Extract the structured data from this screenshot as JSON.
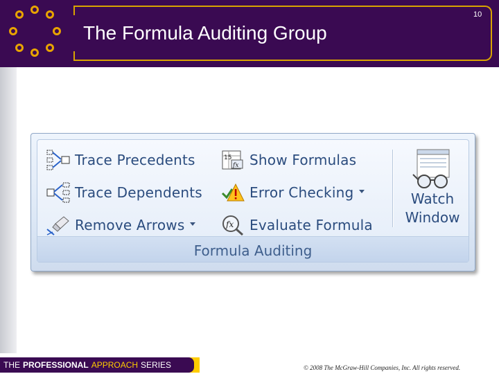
{
  "slide": {
    "title": "The Formula Auditing Group",
    "number": "10"
  },
  "ribbon": {
    "commands": [
      {
        "id": "trace-precedents",
        "label": "Trace Precedents",
        "icon": "trace-precedents-icon"
      },
      {
        "id": "trace-dependents",
        "label": "Trace Dependents",
        "icon": "trace-dependents-icon"
      },
      {
        "id": "remove-arrows",
        "label": "Remove Arrows",
        "icon": "eraser-icon",
        "dropdown": true
      },
      {
        "id": "show-formulas",
        "label": "Show Formulas",
        "icon": "show-formulas-icon"
      },
      {
        "id": "error-checking",
        "label": "Error Checking",
        "icon": "error-checking-icon",
        "dropdown": true
      },
      {
        "id": "evaluate-formula",
        "label": "Evaluate Formula",
        "icon": "evaluate-formula-icon"
      }
    ],
    "watch_window": {
      "line1": "Watch",
      "line2": "Window",
      "icon": "watch-window-icon"
    },
    "group_label": "Formula Auditing"
  },
  "footer": {
    "series_the": "THE",
    "series_professional": "PROFESSIONAL",
    "series_approach": "APPROACH",
    "series_series": "SERIES",
    "copyright": "© 2008 The McGraw-Hill Companies, Inc. All rights reserved."
  },
  "colors": {
    "header_bg": "#3a0a52",
    "accent_gold": "#d9a400",
    "ribbon_text": "#2b4c7e",
    "footer_yellow": "#ffcc00"
  }
}
